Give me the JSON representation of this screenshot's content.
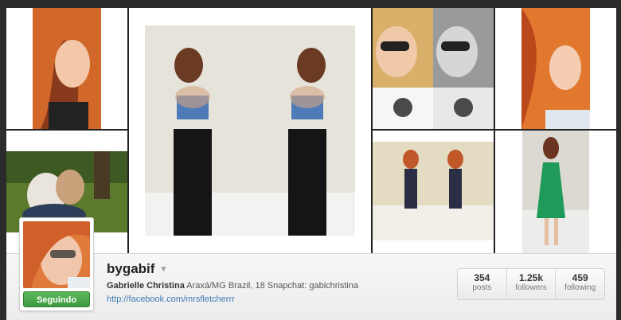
{
  "profile": {
    "username": "bygabif",
    "full_name": "Gabrielle Christina",
    "bio": "Araxá/MG Brazil, 18 Snapchat: gabichristina",
    "website": "http://facebook.com/mrsfletcherrr",
    "follow_button_label": "Seguindo",
    "dropdown_icon": "caret-down-icon"
  },
  "stats": [
    {
      "value": "354",
      "label": "posts"
    },
    {
      "value": "1.25k",
      "label": "followers"
    },
    {
      "value": "459",
      "label": "following"
    }
  ],
  "colors": {
    "background": "#2b2b2b",
    "follow_button": "#4aa84a",
    "link": "#3e7bb6"
  }
}
